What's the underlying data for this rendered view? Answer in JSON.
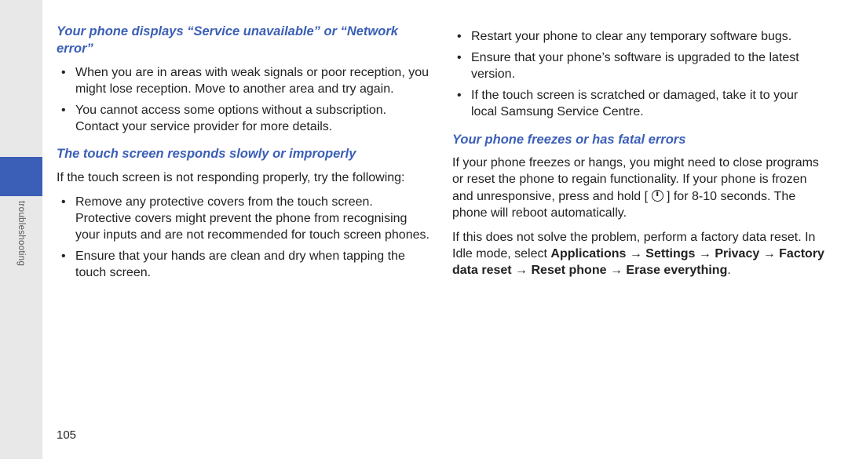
{
  "sidebar": {
    "label": "troubleshooting"
  },
  "page_number": "105",
  "left": {
    "heading1": "Your phone displays “Service unavailable” or “Network error”",
    "bullets1": [
      "When you are in areas with weak signals or poor reception, you might lose reception. Move to another area and try again.",
      "You cannot access some options without a subscription. Contact your service provider for more details."
    ],
    "heading2": "The touch screen responds slowly or improperly",
    "para1": "If the touch screen is not responding properly, try the following:",
    "bullets2": [
      "Remove any protective covers from the touch screen. Protective covers might prevent the phone from recognising your inputs and are not recommended for touch screen phones.",
      "Ensure that your hands are clean and dry when tapping the touch screen."
    ]
  },
  "right": {
    "bullets1": [
      "Restart your phone to clear any temporary software bugs.",
      "Ensure that your phone’s software is upgraded to the latest version.",
      "If the touch screen is scratched or damaged, take it to your local Samsung Service Centre."
    ],
    "heading1": "Your phone freezes or has fatal errors",
    "para1_a": "If your phone freezes or hangs, you might need to close programs or reset the phone to regain functionality. If your phone is frozen and unresponsive, press and hold [",
    "para1_b": "] for 8-10 seconds. The phone will reboot automatically.",
    "para2_a": "If this does not solve the problem, perform a factory data reset. In Idle mode, select ",
    "path": "Applications → Settings → Privacy → Factory data reset → Reset phone → Erase everything",
    "para2_b": "."
  }
}
